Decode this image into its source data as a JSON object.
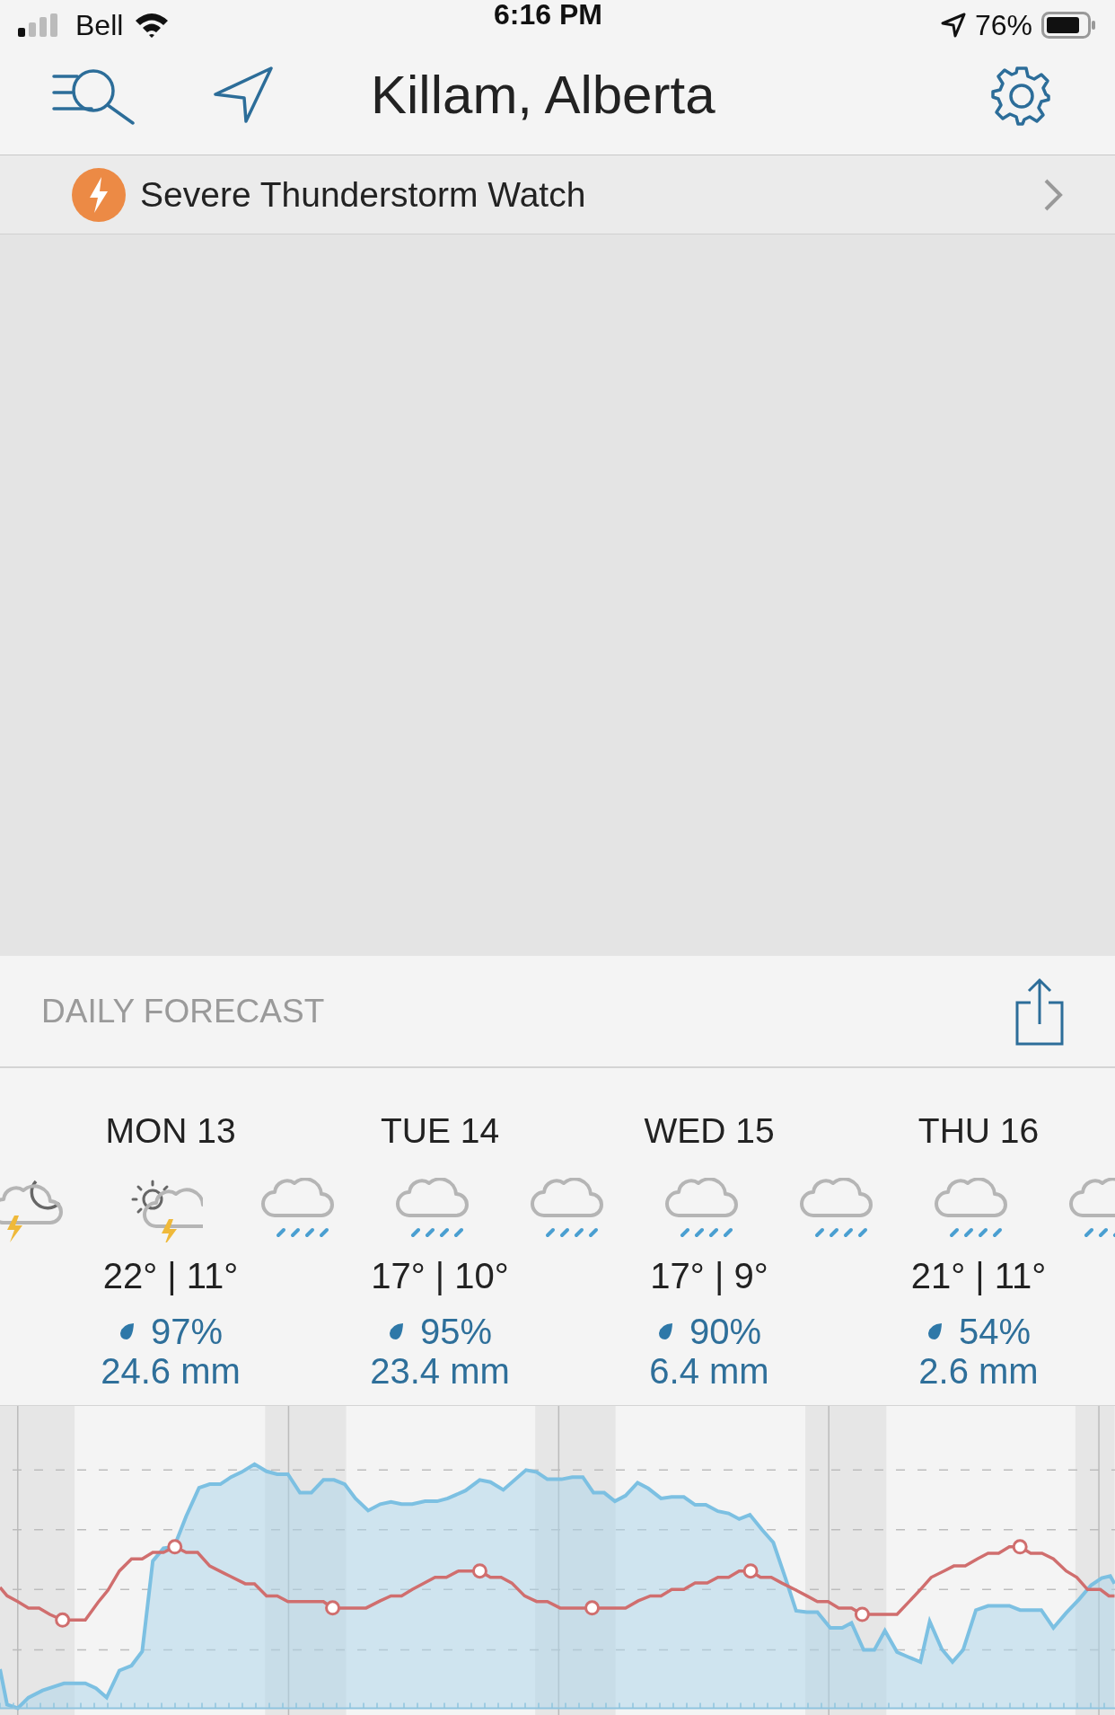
{
  "status_bar": {
    "carrier": "Bell",
    "time": "6:16 PM",
    "battery": "76%"
  },
  "header": {
    "title": "Killam, Alberta"
  },
  "alert": {
    "text": "Severe Thunderstorm Watch"
  },
  "daily_forecast": {
    "title": "DAILY FORECAST",
    "days": [
      {
        "label": "MON 13",
        "temps": "22° | 11°",
        "chance": "97%",
        "amount": "24.6 mm"
      },
      {
        "label": "TUE 14",
        "temps": "17° | 10°",
        "chance": "95%",
        "amount": "23.4 mm"
      },
      {
        "label": "WED 15",
        "temps": "17° | 9°",
        "chance": "90%",
        "amount": "6.4 mm"
      },
      {
        "label": "THU 16",
        "temps": "21° | 11°",
        "chance": "54%",
        "amount": "2.6 mm"
      }
    ],
    "icons": [
      {
        "kind": "night-thunder"
      },
      {
        "kind": "day-thunder"
      },
      {
        "kind": "rain"
      },
      {
        "kind": "rain"
      },
      {
        "kind": "rain"
      },
      {
        "kind": "rain"
      },
      {
        "kind": "rain"
      },
      {
        "kind": "rain"
      },
      {
        "kind": "rain"
      }
    ]
  }
}
